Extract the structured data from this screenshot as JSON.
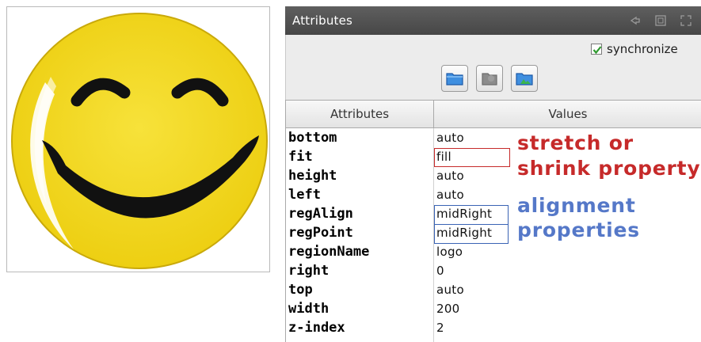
{
  "panel": {
    "title": "Attributes",
    "synchronize_label": "synchronize",
    "synchronize_checked": true
  },
  "table": {
    "headers": {
      "name": "Attributes",
      "value": "Values"
    },
    "rows": [
      {
        "name": "bottom",
        "value": "auto"
      },
      {
        "name": "fit",
        "value": "fill"
      },
      {
        "name": "height",
        "value": "auto"
      },
      {
        "name": "left",
        "value": "auto"
      },
      {
        "name": "regAlign",
        "value": "midRight"
      },
      {
        "name": "regPoint",
        "value": "midRight"
      },
      {
        "name": "regionName",
        "value": "logo"
      },
      {
        "name": "right",
        "value": "0"
      },
      {
        "name": "top",
        "value": "auto"
      },
      {
        "name": "width",
        "value": "200"
      },
      {
        "name": "z-index",
        "value": "2"
      }
    ]
  },
  "annotations": {
    "fit_line1": "stretch or",
    "fit_line2": "shrink property",
    "align_line1": "alignment",
    "align_line2": "properties"
  },
  "colors": {
    "annotation_red": "#c62a2a",
    "annotation_blue": "#5578c8",
    "smiley_yellow": "#f2d91e",
    "titlebar": "#4f4f4f"
  },
  "icons": {
    "titlebar": [
      "minimize-icon",
      "restore-icon",
      "maximize-icon"
    ],
    "toolbar": [
      "folder-icon",
      "disabled-save-icon",
      "folder-image-icon"
    ]
  }
}
